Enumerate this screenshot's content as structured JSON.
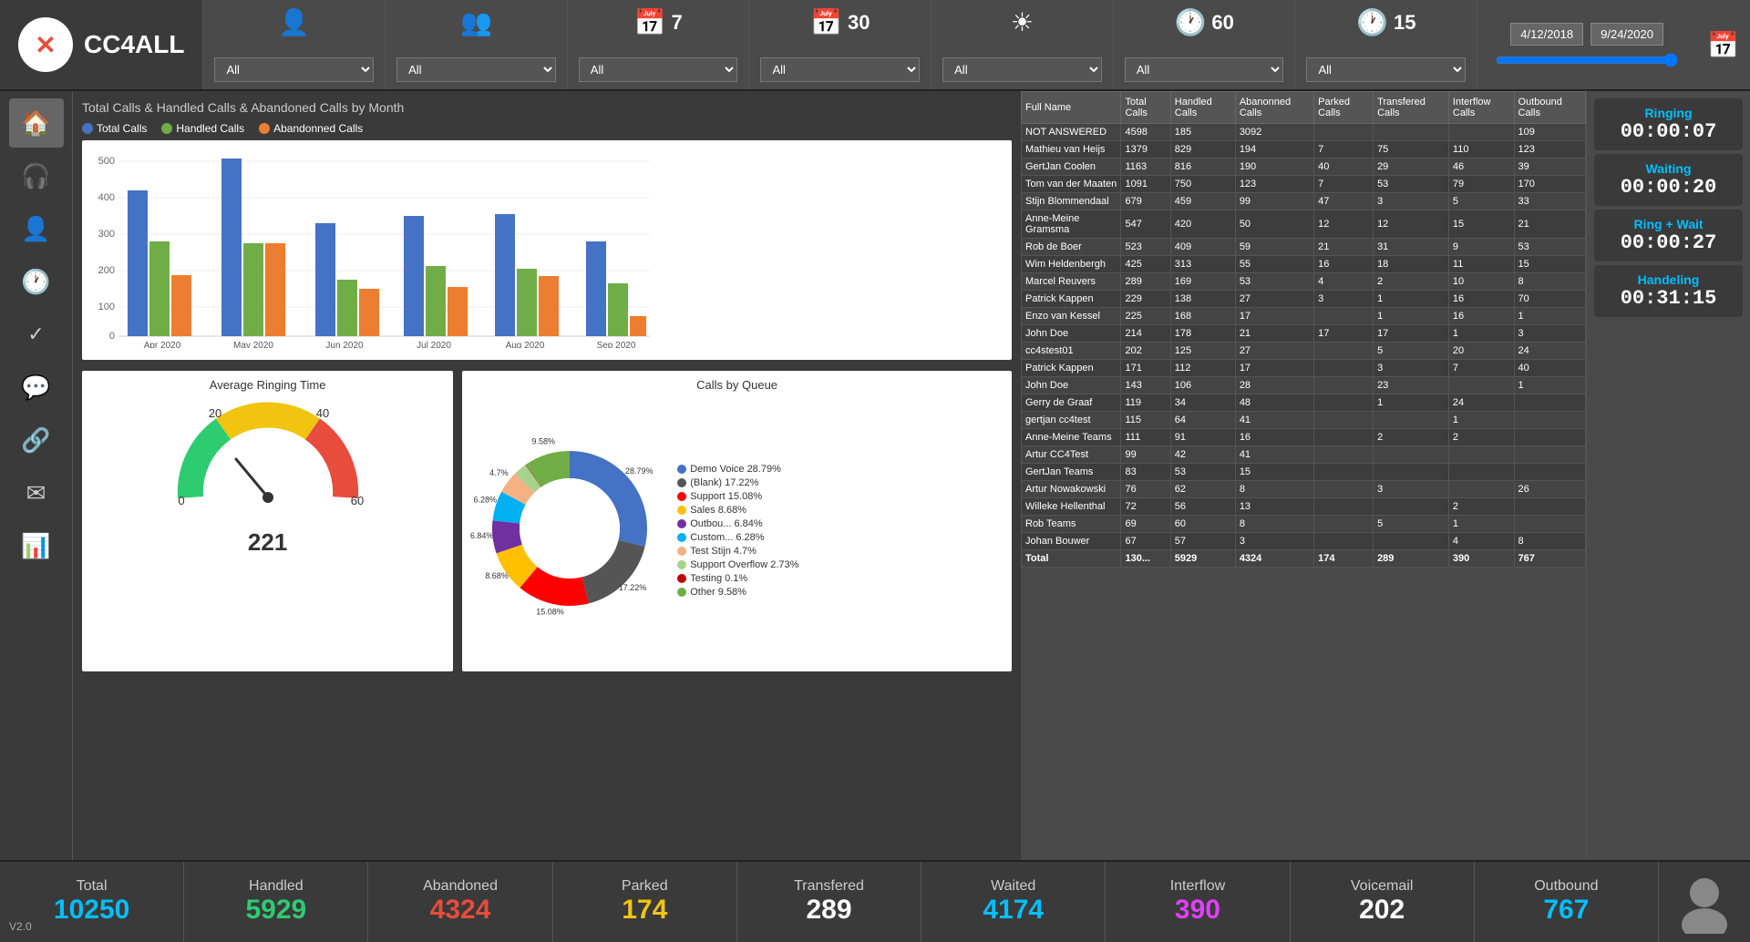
{
  "logo": {
    "text": "CC4ALL",
    "x_symbol": "✕"
  },
  "header": {
    "cols": [
      {
        "icon": "👤",
        "number": "",
        "select_options": [
          "All"
        ],
        "select_value": "All"
      },
      {
        "icon": "👥",
        "number": "",
        "select_options": [
          "All"
        ],
        "select_value": "All"
      },
      {
        "icon": "📅",
        "number": "7",
        "select_options": [
          "All"
        ],
        "select_value": "All"
      },
      {
        "icon": "📅",
        "number": "30",
        "select_options": [
          "All"
        ],
        "select_value": "All"
      },
      {
        "icon": "☀",
        "number": "",
        "select_options": [
          "All"
        ],
        "select_value": "All"
      },
      {
        "icon": "🕐",
        "number": "60",
        "select_options": [
          "All"
        ],
        "select_value": "All"
      },
      {
        "icon": "🕐",
        "number": "15",
        "select_options": [
          "All"
        ],
        "select_value": "All"
      }
    ],
    "date_from": "4/12/2018",
    "date_to": "9/24/2020"
  },
  "sidebar": {
    "items": [
      {
        "icon": "🏠",
        "label": "home"
      },
      {
        "icon": "🎧",
        "label": "headset"
      },
      {
        "icon": "👤",
        "label": "user"
      },
      {
        "icon": "🕐",
        "label": "clock"
      },
      {
        "icon": "✓",
        "label": "check"
      },
      {
        "icon": "💬",
        "label": "chat"
      },
      {
        "icon": "🔗",
        "label": "share"
      },
      {
        "icon": "✉",
        "label": "mail"
      },
      {
        "icon": "📊",
        "label": "chart"
      }
    ]
  },
  "main_chart": {
    "title": "Total Calls & Handled Calls & Abandoned Calls by Month",
    "legend": [
      {
        "label": "Total Calls",
        "color": "#4472c4"
      },
      {
        "label": "Handled Calls",
        "color": "#70ad47"
      },
      {
        "label": "Abandonned Calls",
        "color": "#ed7d31"
      }
    ],
    "bars": [
      {
        "month": "Apr 2020",
        "total": 420,
        "handled": 270,
        "abandoned": 175
      },
      {
        "month": "May 2020",
        "total": 495,
        "handled": 255,
        "abandoned": 255
      },
      {
        "month": "Jun 2020",
        "total": 310,
        "handled": 155,
        "abandoned": 130
      },
      {
        "month": "Jul 2020",
        "total": 330,
        "handled": 195,
        "abandoned": 135
      },
      {
        "month": "Aug 2020",
        "total": 335,
        "handled": 185,
        "abandoned": 165
      },
      {
        "month": "Sep 2020",
        "total": 260,
        "handled": 145,
        "abandoned": 55
      }
    ],
    "y_max": 500,
    "y_labels": [
      0,
      100,
      200,
      300,
      400,
      500
    ]
  },
  "gauge": {
    "title": "Average Ringing Time",
    "value": 221,
    "min": 0,
    "max": 60,
    "ticks": [
      0,
      20,
      40,
      60
    ],
    "needle_angle": 200
  },
  "donut": {
    "title": "Calls by Queue",
    "segments": [
      {
        "label": "Demo Voice",
        "percent": 28.79,
        "color": "#4472c4"
      },
      {
        "label": "(Blank)",
        "percent": 17.22,
        "color": "#555555"
      },
      {
        "label": "Support",
        "percent": 15.08,
        "color": "#ff0000"
      },
      {
        "label": "Sales",
        "percent": 8.68,
        "color": "#ffc000"
      },
      {
        "label": "Outbou...",
        "percent": 6.84,
        "color": "#7030a0"
      },
      {
        "label": "Custom...",
        "percent": 6.28,
        "color": "#00b0f0"
      },
      {
        "label": "Test Stijn",
        "percent": 4.7,
        "color": "#f4b183"
      },
      {
        "label": "Support Overflow",
        "percent": 2.73,
        "color": "#a9d18e"
      },
      {
        "label": "Testing",
        "percent": 0.1,
        "color": "#c00000"
      },
      {
        "label": "Other",
        "percent": 9.58,
        "color": "#70ad47"
      }
    ]
  },
  "table": {
    "columns": [
      "Full Name",
      "Total Calls",
      "Handled Calls",
      "Abanonned Calls",
      "Parked Calls",
      "Transfered Calls",
      "Interflow Calls",
      "Outbound Calls"
    ],
    "rows": [
      {
        "name": "NOT ANSWERED",
        "total": 4598,
        "handled": 185,
        "abandoned": 3092,
        "parked": "",
        "transferred": "",
        "interflow": "",
        "outbound": 109
      },
      {
        "name": "Mathieu van Heijs",
        "total": 1379,
        "handled": 829,
        "abandoned": 194,
        "parked": 7,
        "transferred": 75,
        "interflow": 110,
        "outbound": 123
      },
      {
        "name": "GertJan Coolen",
        "total": 1163,
        "handled": 816,
        "abandoned": 190,
        "parked": 40,
        "transferred": 29,
        "interflow": 46,
        "outbound": 39
      },
      {
        "name": "Tom van der Maaten",
        "total": 1091,
        "handled": 750,
        "abandoned": 123,
        "parked": 7,
        "transferred": 53,
        "interflow": 79,
        "outbound": 170
      },
      {
        "name": "Stijn Blommendaal",
        "total": 679,
        "handled": 459,
        "abandoned": 99,
        "parked": 47,
        "transferred": 3,
        "interflow": 5,
        "outbound": 33
      },
      {
        "name": "Anne-Meine Gramsma",
        "total": 547,
        "handled": 420,
        "abandoned": 50,
        "parked": 12,
        "transferred": 12,
        "interflow": 15,
        "outbound": 21
      },
      {
        "name": "Rob de Boer",
        "total": 523,
        "handled": 409,
        "abandoned": 59,
        "parked": 21,
        "transferred": 31,
        "interflow": 9,
        "outbound": 53
      },
      {
        "name": "Wim Heldenbergh",
        "total": 425,
        "handled": 313,
        "abandoned": 55,
        "parked": 16,
        "transferred": 18,
        "interflow": 11,
        "outbound": 15
      },
      {
        "name": "Marcel Reuvers",
        "total": 289,
        "handled": 169,
        "abandoned": 53,
        "parked": 4,
        "transferred": 2,
        "interflow": 10,
        "outbound": 8
      },
      {
        "name": "Patrick Kappen",
        "total": 229,
        "handled": 138,
        "abandoned": 27,
        "parked": 3,
        "transferred": 1,
        "interflow": 16,
        "outbound": 70
      },
      {
        "name": "Enzo van Kessel",
        "total": 225,
        "handled": 168,
        "abandoned": 17,
        "parked": "",
        "transferred": 1,
        "interflow": 16,
        "outbound": 1
      },
      {
        "name": "John Doe",
        "total": 214,
        "handled": 178,
        "abandoned": 21,
        "parked": 17,
        "transferred": 17,
        "interflow": 1,
        "outbound": 3
      },
      {
        "name": "cc4stest01",
        "total": 202,
        "handled": 125,
        "abandoned": 27,
        "parked": "",
        "transferred": 5,
        "interflow": 20,
        "outbound": 24
      },
      {
        "name": "Patrick Kappen",
        "total": 171,
        "handled": 112,
        "abandoned": 17,
        "parked": "",
        "transferred": 3,
        "interflow": 7,
        "outbound": 40
      },
      {
        "name": "John Doe",
        "total": 143,
        "handled": 106,
        "abandoned": 28,
        "parked": "",
        "transferred": 23,
        "interflow": "",
        "outbound": 1
      },
      {
        "name": "Gerry de Graaf",
        "total": 119,
        "handled": 34,
        "abandoned": 48,
        "parked": "",
        "transferred": 1,
        "interflow": 24,
        "outbound": ""
      },
      {
        "name": "gertjan cc4test",
        "total": 115,
        "handled": 64,
        "abandoned": 41,
        "parked": "",
        "transferred": "",
        "interflow": 1,
        "outbound": ""
      },
      {
        "name": "Anne-Meine Teams",
        "total": 111,
        "handled": 91,
        "abandoned": 16,
        "parked": "",
        "transferred": 2,
        "interflow": 2,
        "outbound": ""
      },
      {
        "name": "Artur CC4Test",
        "total": 99,
        "handled": 42,
        "abandoned": 41,
        "parked": "",
        "transferred": "",
        "interflow": "",
        "outbound": ""
      },
      {
        "name": "GertJan Teams",
        "total": 83,
        "handled": 53,
        "abandoned": 15,
        "parked": "",
        "transferred": "",
        "interflow": "",
        "outbound": ""
      },
      {
        "name": "Artur Nowakowski",
        "total": 76,
        "handled": 62,
        "abandoned": 8,
        "parked": "",
        "transferred": 3,
        "interflow": "",
        "outbound": 26
      },
      {
        "name": "Willeke Hellenthal",
        "total": 72,
        "handled": 56,
        "abandoned": 13,
        "parked": "",
        "transferred": "",
        "interflow": 2,
        "outbound": ""
      },
      {
        "name": "Rob Teams",
        "total": 69,
        "handled": 60,
        "abandoned": 8,
        "parked": "",
        "transferred": 5,
        "interflow": 1,
        "outbound": ""
      },
      {
        "name": "Johan Bouwer",
        "total": 67,
        "handled": 57,
        "abandoned": 3,
        "parked": "",
        "transferred": "",
        "interflow": 4,
        "outbound": 8
      }
    ],
    "total_row": {
      "name": "Total",
      "total": "130...",
      "handled": 5929,
      "abandoned": 4324,
      "parked": 174,
      "transferred": 289,
      "interflow": 390,
      "outbound": 767
    }
  },
  "right_metrics": {
    "ringing": {
      "label": "Ringing",
      "value": "00:00:07"
    },
    "waiting": {
      "label": "Waiting",
      "value": "00:00:20"
    },
    "ring_wait": {
      "label": "Ring + Wait",
      "value": "00:00:27"
    },
    "handling": {
      "label": "Handeling",
      "value": "00:31:15"
    }
  },
  "footer": {
    "stats": [
      {
        "label": "Total",
        "value": "10250",
        "color": "cyan"
      },
      {
        "label": "Handled",
        "value": "5929",
        "color": "green"
      },
      {
        "label": "Abandoned",
        "value": "4324",
        "color": "red"
      },
      {
        "label": "Parked",
        "value": "174",
        "color": "yellow"
      },
      {
        "label": "Transfered",
        "value": "289",
        "color": "white"
      },
      {
        "label": "Waited",
        "value": "4174",
        "color": "cyan"
      },
      {
        "label": "Interflow",
        "value": "390",
        "color": "magenta"
      },
      {
        "label": "Voicemail",
        "value": "202",
        "color": "white"
      },
      {
        "label": "Outbound",
        "value": "767",
        "color": "cyan"
      }
    ],
    "version": "V2.0"
  }
}
